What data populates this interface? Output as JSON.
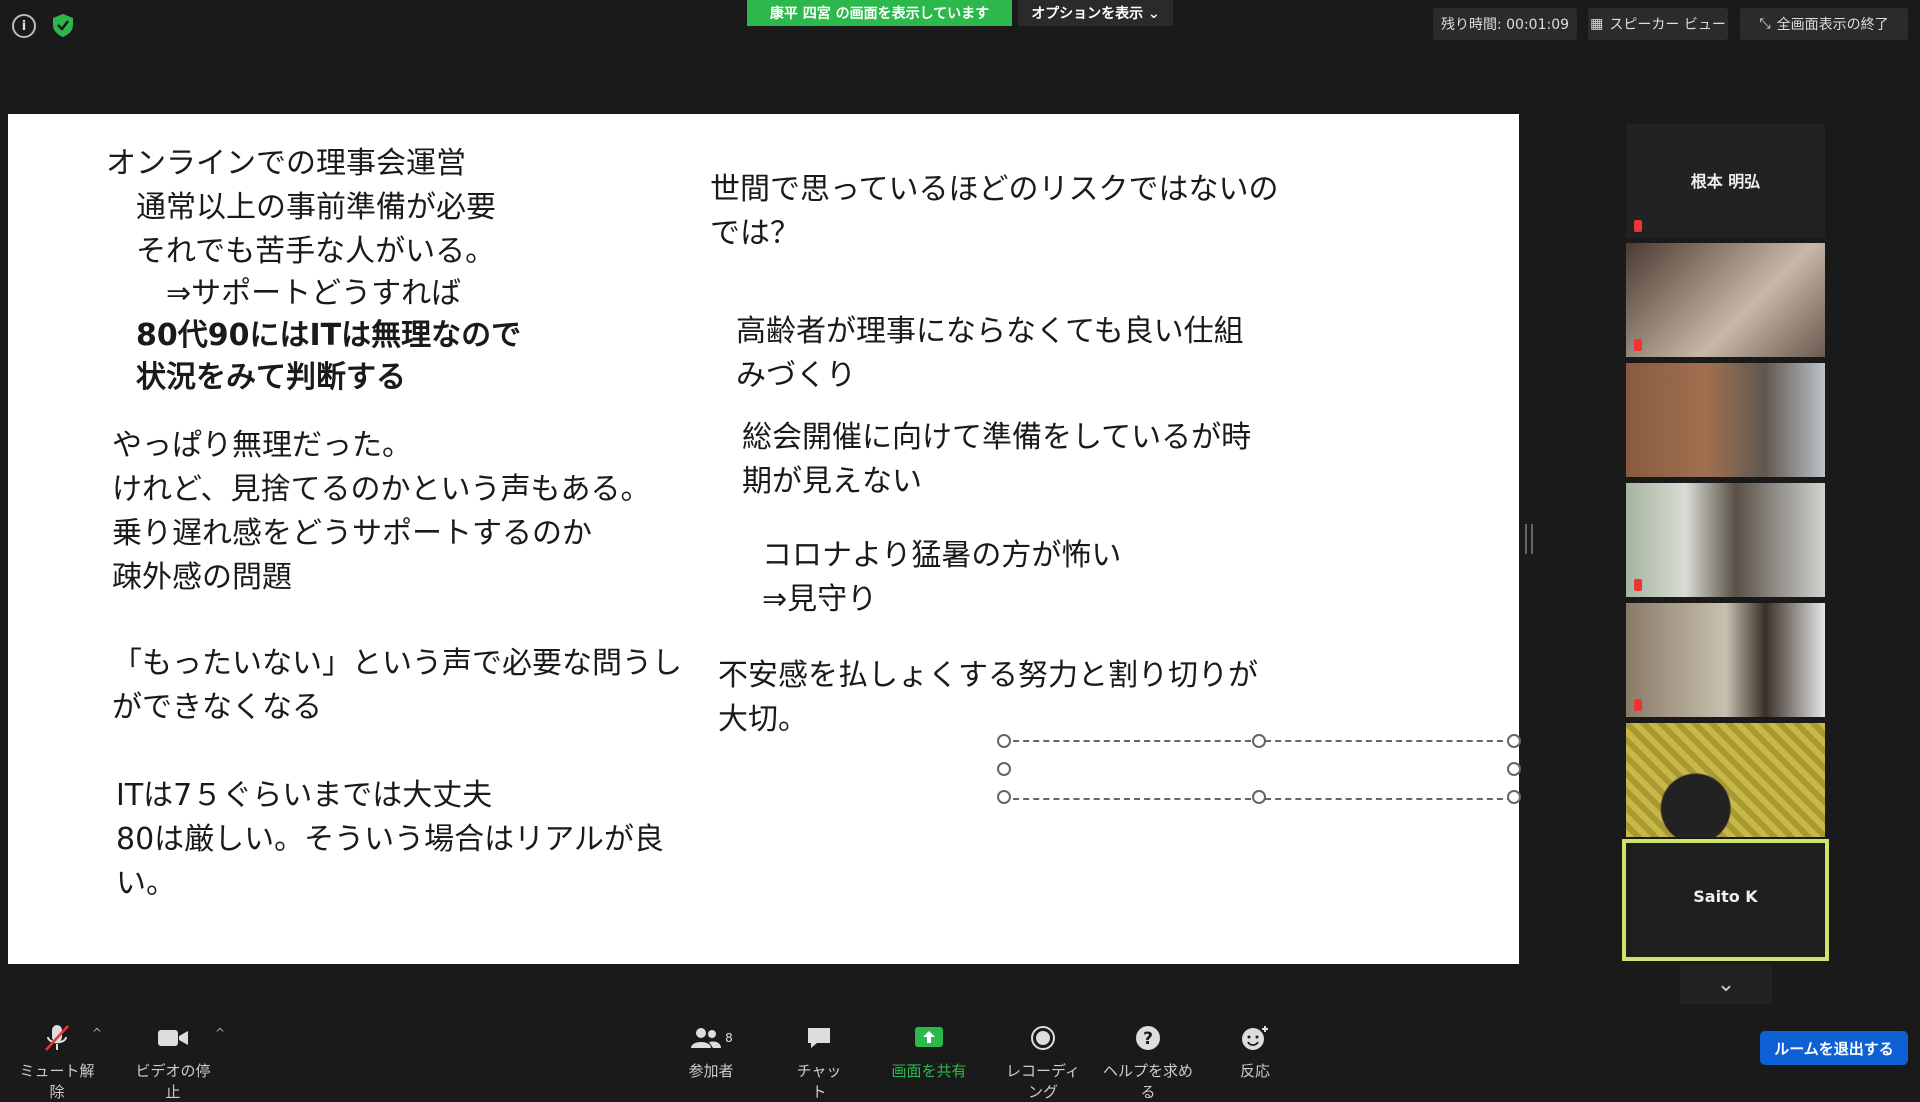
{
  "top": {
    "share_banner": "康平 四宮 の画面を表示しています",
    "options": "オプションを表示 ⌄",
    "timer_label": "残り時間: 00:01:09",
    "speaker_view": "スピーカー ビュー",
    "exit_fullscreen": "全画面表示の終了"
  },
  "slide": {
    "left": [
      "オンラインでの理事会運営",
      "　通常以上の事前準備が必要",
      "　それでも苦手な人がいる。",
      "　　⇒サポートどうすれば",
      "　80代90にはITは無理なので",
      "　状況をみて判断する",
      "やっぱり無理だった。",
      "けれど、見捨てるのかという声もある。",
      "乗り遅れ感をどうサポートするのか",
      "疎外感の問題",
      "「もったいない」という声で必要な問うし",
      "ができなくなる",
      "ITは7５ぐらいまでは大丈夫",
      "80は厳しい。そういう場合はリアルが良",
      "い。"
    ],
    "right": [
      "世間で思っているほどのリスクではないの",
      "では？",
      "高齢者が理事にならなくても良い仕組",
      "みづくり",
      "総会開催に向けて準備をしているが時",
      "期が見えない",
      "コロナより猛暑の方が怖い",
      "⇒見守り",
      "不安感を払しょくする努力と割り切りが",
      "大切。"
    ]
  },
  "gallery": {
    "tile1_name": "根本 明弘",
    "tile_last_name": "Saito K"
  },
  "toolbar": {
    "mute": "ミュート解除",
    "video": "ビデオの停止",
    "participants": "参加者",
    "participants_count": "8",
    "chat": "チャット",
    "share": "画面を共有",
    "record": "レコーディング",
    "help": "ヘルプを求める",
    "reactions": "反応",
    "leave": "ルームを退出する"
  },
  "colors": {
    "share_green": "#2db84b",
    "leave_blue": "#0e61d4",
    "active_speaker": "#cbe46d"
  }
}
